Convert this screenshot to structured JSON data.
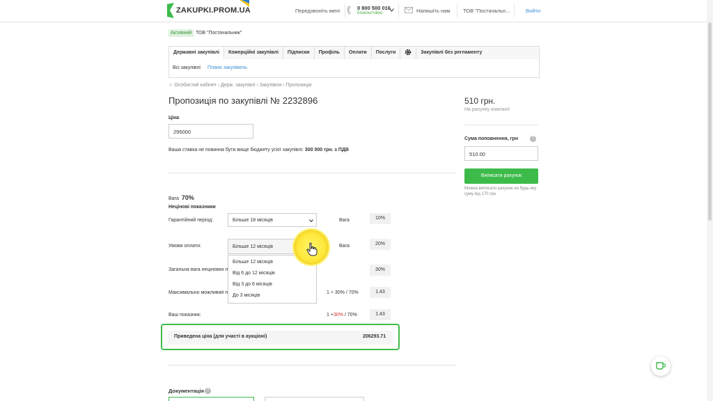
{
  "header": {
    "logo_text": "ZAKUPKI.PROM.UA",
    "callback_label": "Передзвоніть мені",
    "phone_number": "0 800 500 016",
    "phone_sub": "Безкоштовно",
    "write_label": "Напишіть нам",
    "account_name": "ТОВ \"Постачальн...",
    "logout_label": "Вийти",
    "brand_color": "#3dbb4a"
  },
  "status": {
    "badge": "Активний",
    "company": "ТОВ \"Постачальник\""
  },
  "tabs": [
    {
      "label": "Державні закупівлі",
      "active": true
    },
    {
      "label": "Комерційні закупівлі",
      "active": false
    },
    {
      "label": "Підписки",
      "active": false
    },
    {
      "label": "Профіль",
      "active": false
    },
    {
      "label": "Оплати",
      "active": false
    },
    {
      "label": "Послуги",
      "active": false
    },
    {
      "label": "Закупівлі без регламенту",
      "active": false
    }
  ],
  "subnav": {
    "all": "Всі закупівлі",
    "plans": "Плани закупівель"
  },
  "breadcrumb": "☆ Особистий кабінет › Держ. закупівлі › Закупівля › Пропозиція",
  "page_title": "Пропозиція по закупівлі № 2232896",
  "price": {
    "label": "Ціна",
    "value": "295000",
    "note_prefix": "Ваша ставка не повинна бути вище бюджету усієї закупівлі: ",
    "note_amount": "300 000 грн. з ПДВ"
  },
  "weights": {
    "weight_label": "Вага",
    "weight_value": "70%",
    "nonprice_title": "Нецінові показники",
    "warranty_label": "Гарантійний період:",
    "warranty_selected": "Більше 18 місяців",
    "warranty_weight_label": "Вага",
    "warranty_weight": "10%",
    "payment_label": "Умови оплати:",
    "payment_selected": "Більше 12 місяців",
    "payment_weight_label": "Вага",
    "payment_weight": "20%",
    "total_label": "Загальна вага нецінових п",
    "total_weight": "30%",
    "max_label": "Максимально можливий п",
    "max_formula": "1 + 30% / 70%",
    "max_value": "1.43",
    "yours_label": "Ваш показник:",
    "yours_formula_prefix": "1 +",
    "yours_formula_red": "30%",
    "yours_formula_suffix": " / 70%",
    "yours_value": "1.43",
    "payment_options": [
      "Більше 12 місяців",
      "Від 6 до 12 місяців",
      "Від 3 до 6 місяців",
      "До 3 місяців"
    ]
  },
  "result": {
    "label": "Приведена ціна (для участі в аукціоні)",
    "value": "206293.71"
  },
  "sidebar": {
    "balance": "510 грн.",
    "balance_sub": "На рахунку компанії",
    "topup_label": "Сума поповнення, грн",
    "topup_value": "510.00",
    "invoice_button": "Виписати рахунок",
    "invoice_note": "Можна виписати рахунок на будь-яку суму від 170 грн."
  },
  "documents_label": "Документація"
}
